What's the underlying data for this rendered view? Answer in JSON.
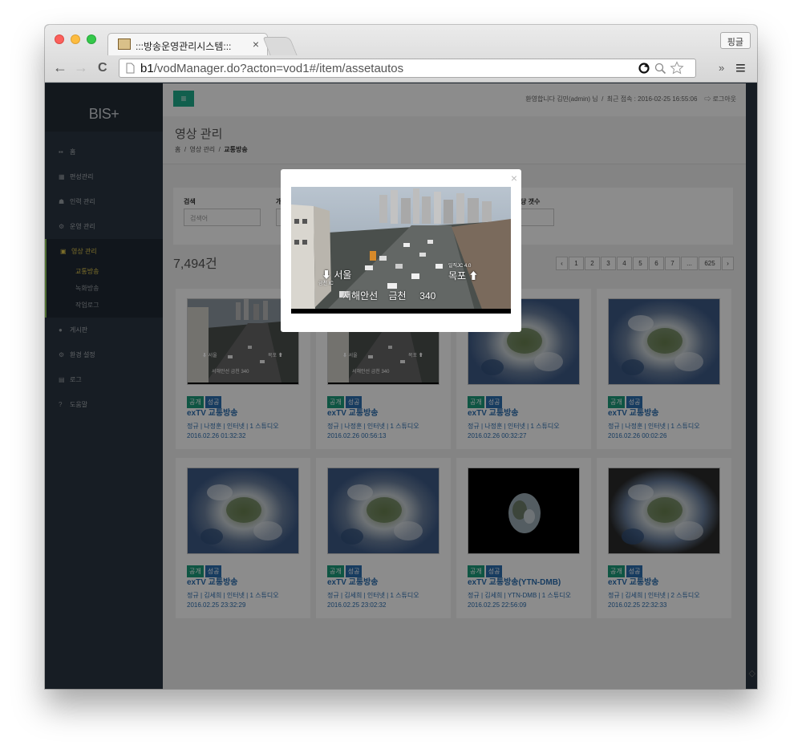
{
  "browser": {
    "tab_title": ":::방송운영관리시스템:::",
    "tab_close": "×",
    "user_button": "핑글",
    "back": "←",
    "forward": "→",
    "reload": "C",
    "url_host": "b1",
    "url_path": "/vodManager.do?acton=vod1#/item/assetautos",
    "more": "»",
    "menu": "≡"
  },
  "sidebar": {
    "logo": "BIS+",
    "items": [
      {
        "icon": "▪▪",
        "label": "홈"
      },
      {
        "icon": "▦",
        "label": "편성관리"
      },
      {
        "icon": "☗",
        "label": "인력 관리"
      },
      {
        "icon": "⚙",
        "label": "운영 관리"
      },
      {
        "icon": "▣",
        "label": "영상 관리"
      },
      {
        "icon": "●",
        "label": "게시판"
      },
      {
        "icon": "⚙",
        "label": "환경 설정"
      },
      {
        "icon": "▤",
        "label": "로그"
      },
      {
        "icon": "?",
        "label": "도움말"
      }
    ],
    "subitems": [
      "교통방송",
      "녹화방송",
      "작업로그"
    ]
  },
  "topbar": {
    "menu_icon": "≡",
    "welcome": "환영합니다 김민(admin) 님",
    "last_login": "최근 접속 : 2016-02-25 16:55:06",
    "logout": "로그아웃"
  },
  "header": {
    "title": "영상 관리",
    "breadcrumb": [
      "홈",
      "영상 관리",
      "교통방송"
    ]
  },
  "search": {
    "label": "검색",
    "placeholder": "검색어",
    "label2": "개",
    "label3": "당 갯수"
  },
  "list": {
    "count": "7,494건"
  },
  "pagination": [
    "‹",
    "1",
    "2",
    "3",
    "4",
    "5",
    "6",
    "7",
    "...",
    "625",
    "›"
  ],
  "cards": [
    {
      "b1": "공개",
      "b2": "성공",
      "title": "exTV 교통방송",
      "meta": "정규 | 나정훈 | 인터넷 | 1 스튜디오",
      "date": "2016.02.26 01:32:32"
    },
    {
      "b1": "공개",
      "b2": "성공",
      "title": "exTV 교통방송",
      "meta": "정규 | 나정훈 | 인터넷 | 1 스튜디오",
      "date": "2016.02.26 00:56:13"
    },
    {
      "b1": "공개",
      "b2": "성공",
      "title": "exTV 교통방송",
      "meta": "정규 | 나정훈 | 인터넷 | 1 스튜디오",
      "date": "2016.02.26 00:32:27"
    },
    {
      "b1": "공개",
      "b2": "성공",
      "title": "exTV 교통방송",
      "meta": "정규 | 나정훈 | 인터넷 | 1 스튜디오",
      "date": "2016.02.26 00:02:26"
    },
    {
      "b1": "공개",
      "b2": "성공",
      "title": "exTV 교통방송",
      "meta": "정규 | 김세희 | 인터넷 | 1 스튜디오",
      "date": "2016.02.25 23:32:29"
    },
    {
      "b1": "공개",
      "b2": "성공",
      "title": "exTV 교통방송",
      "meta": "정규 | 김세희 | 인터넷 | 1 스튜디오",
      "date": "2016.02.25 23:02:32"
    },
    {
      "b1": "공개",
      "b2": "성공",
      "title": "exTV 교통방송(YTN-DMB)",
      "meta": "정규 | 김세희 | YTN-DMB | 1 스튜디오",
      "date": "2016.02.25 22:56:09"
    },
    {
      "b1": "공개",
      "b2": "성공",
      "title": "exTV 교통방송",
      "meta": "정규 | 김세희 | 인터넷 | 2 스튜디오",
      "date": "2016.02.25 22:32:33"
    }
  ],
  "modal": {
    "close": "×",
    "overlay_left": "서울",
    "overlay_sub": "금천 IC",
    "overlay_right": "목포",
    "overlay_jc": "일직JC 4.0",
    "overlay_bottom": [
      "서해안선",
      "금천",
      "340"
    ]
  }
}
